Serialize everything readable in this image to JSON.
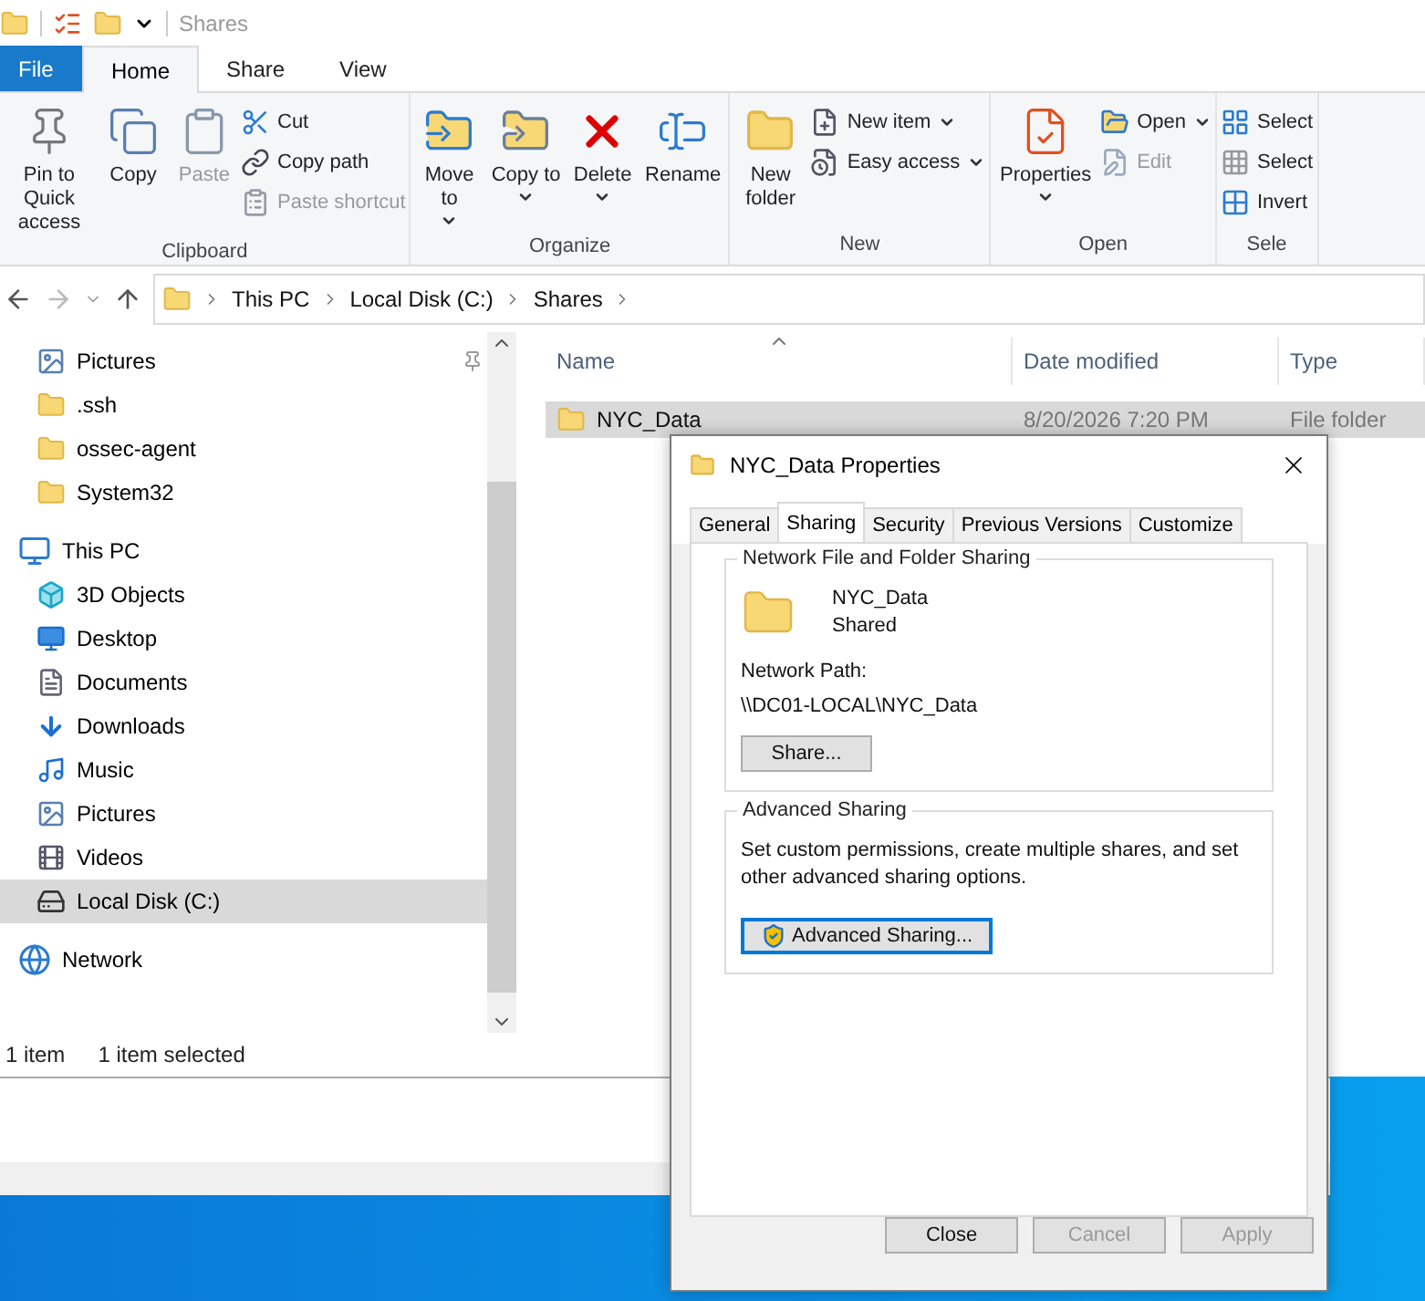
{
  "title_bar": {
    "title": "Shares"
  },
  "ribbon_tabs": [
    {
      "label": "File",
      "kind": "file",
      "selected": false
    },
    {
      "label": "Home",
      "kind": "tab",
      "selected": true
    },
    {
      "label": "Share",
      "kind": "tab",
      "selected": false
    },
    {
      "label": "View",
      "kind": "tab",
      "selected": false
    }
  ],
  "ribbon_groups": [
    {
      "label": "Clipboard",
      "commands": [
        {
          "label": "Pin to Quick access",
          "kind": "large",
          "disabled": false,
          "dropdown": false
        },
        {
          "label": "Copy",
          "kind": "large",
          "disabled": false,
          "dropdown": false
        },
        {
          "label": "Paste",
          "kind": "large",
          "disabled": true,
          "dropdown": false
        },
        {
          "label": "Cut",
          "kind": "small",
          "disabled": false,
          "dropdown": false
        },
        {
          "label": "Copy path",
          "kind": "small",
          "disabled": false,
          "dropdown": false
        },
        {
          "label": "Paste shortcut",
          "kind": "small",
          "disabled": true,
          "dropdown": false
        }
      ]
    },
    {
      "label": "Organize",
      "commands": [
        {
          "label": "Move to",
          "kind": "large",
          "disabled": false,
          "dropdown": true
        },
        {
          "label": "Copy to",
          "kind": "large",
          "disabled": false,
          "dropdown": true
        },
        {
          "label": "Delete",
          "kind": "large",
          "disabled": false,
          "dropdown": true
        },
        {
          "label": "Rename",
          "kind": "large",
          "disabled": false,
          "dropdown": false
        }
      ]
    },
    {
      "label": "New",
      "commands": [
        {
          "label": "New folder",
          "kind": "large",
          "disabled": false,
          "dropdown": false
        },
        {
          "label": "New item",
          "kind": "small",
          "disabled": false,
          "dropdown": true
        },
        {
          "label": "Easy access",
          "kind": "small",
          "disabled": false,
          "dropdown": true
        }
      ]
    },
    {
      "label": "Open",
      "commands": [
        {
          "label": "Properties",
          "kind": "large",
          "disabled": false,
          "dropdown": true
        },
        {
          "label": "Open",
          "kind": "small",
          "disabled": false,
          "dropdown": true
        },
        {
          "label": "Edit",
          "kind": "small",
          "disabled": true,
          "dropdown": false
        }
      ]
    },
    {
      "label": "Sele",
      "commands": [
        {
          "label": "Select",
          "kind": "small",
          "disabled": false,
          "dropdown": false
        },
        {
          "label": "Select",
          "kind": "small",
          "disabled": false,
          "dropdown": false
        },
        {
          "label": "Invert",
          "kind": "small",
          "disabled": false,
          "dropdown": false
        }
      ]
    }
  ],
  "address_bar": {
    "crumbs": [
      "This PC",
      "Local Disk (C:)",
      "Shares"
    ]
  },
  "nav_pane": {
    "quick_access_items": [
      {
        "label": "Pictures",
        "pinned": true,
        "selected": false
      },
      {
        "label": ".ssh",
        "pinned": false,
        "selected": false
      },
      {
        "label": "ossec-agent",
        "pinned": false,
        "selected": false
      },
      {
        "label": "System32",
        "pinned": false,
        "selected": false
      }
    ],
    "tree": [
      {
        "label": "This PC",
        "selected": false,
        "children": [
          {
            "label": "3D Objects",
            "selected": false
          },
          {
            "label": "Desktop",
            "selected": false
          },
          {
            "label": "Documents",
            "selected": false
          },
          {
            "label": "Downloads",
            "selected": false
          },
          {
            "label": "Music",
            "selected": false
          },
          {
            "label": "Pictures",
            "selected": false
          },
          {
            "label": "Videos",
            "selected": false
          },
          {
            "label": "Local Disk (C:)",
            "selected": true
          }
        ]
      },
      {
        "label": "Network",
        "selected": false
      }
    ]
  },
  "file_list": {
    "columns": [
      {
        "label": "Name",
        "sorted": true
      },
      {
        "label": "Date modified",
        "sorted": false
      },
      {
        "label": "Type",
        "sorted": false
      }
    ],
    "rows": [
      {
        "name": "NYC_Data",
        "date_modified": "8/20/2026 7:20 PM",
        "type": "File folder",
        "selected": true
      }
    ]
  },
  "status_bar": {
    "item_count": "1 item",
    "selection": "1 item selected"
  },
  "properties_dialog": {
    "title": "NYC_Data Properties",
    "tabs": [
      {
        "label": "General",
        "selected": false
      },
      {
        "label": "Sharing",
        "selected": true
      },
      {
        "label": "Security",
        "selected": false
      },
      {
        "label": "Previous Versions",
        "selected": false
      },
      {
        "label": "Customize",
        "selected": false
      }
    ],
    "network_sharing": {
      "heading": "Network File and Folder Sharing",
      "folder_name": "NYC_Data",
      "status": "Shared",
      "path_label": "Network Path:",
      "path": "\\\\DC01-LOCAL\\NYC_Data",
      "button": "Share..."
    },
    "advanced_sharing": {
      "heading": "Advanced Sharing",
      "description": "Set custom permissions, create multiple shares, and set other advanced sharing options.",
      "button": {
        "label": "Advanced Sharing...",
        "focused": true
      }
    },
    "buttons": [
      {
        "label": "Close",
        "disabled": false
      },
      {
        "label": "Cancel",
        "disabled": true
      },
      {
        "label": "Apply",
        "disabled": true
      }
    ]
  }
}
